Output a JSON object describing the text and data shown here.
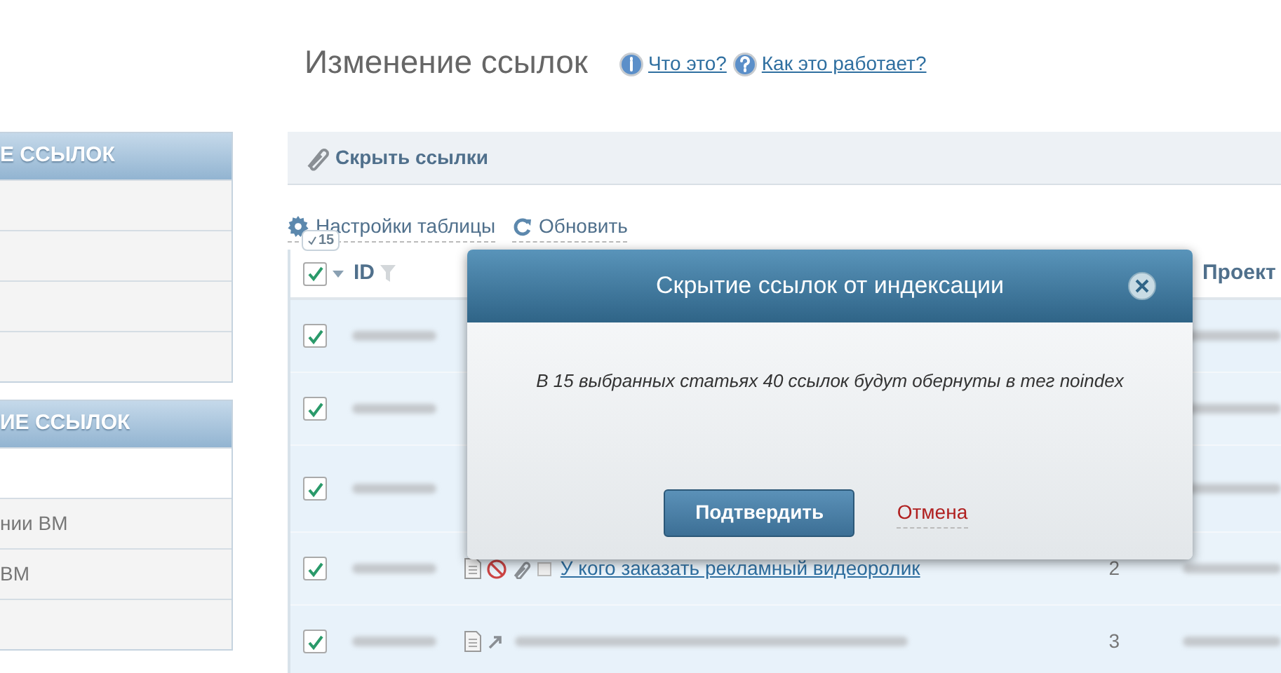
{
  "page": {
    "title": "Изменение ссылок",
    "help_links": [
      {
        "label": "Что это?",
        "kind": "info"
      },
      {
        "label": "Как это работает?",
        "kind": "question"
      }
    ]
  },
  "sidebar": {
    "panels": [
      {
        "title": "Е ССЫЛОК",
        "items": [
          {
            "kind": "blank"
          },
          {
            "kind": "blank"
          },
          {
            "kind": "blank"
          },
          {
            "kind": "blank"
          }
        ]
      },
      {
        "title": "ИЕ ССЫЛОК",
        "items": [
          {
            "kind": "active"
          },
          {
            "kind": "text",
            "label": "нии ВМ"
          },
          {
            "kind": "text",
            "label": "ВМ"
          },
          {
            "kind": "blank"
          }
        ]
      }
    ]
  },
  "toolbar": {
    "button": "Скрыть ссылки"
  },
  "table_actions": [
    {
      "label": "Настройки таблицы",
      "kind": "settings"
    },
    {
      "label": "Обновить",
      "kind": "refresh"
    }
  ],
  "table": {
    "selected_count": "15",
    "all_checked": true,
    "columns": [
      "ID",
      "Проект"
    ],
    "rows": [
      {
        "checked": true
      },
      {
        "checked": true
      },
      {
        "checked": true
      },
      {
        "checked": true,
        "title": "У кого заказать рекламный видеоролик",
        "count": "2"
      },
      {
        "checked": true,
        "count": "3"
      }
    ]
  },
  "dialog": {
    "title": "Скрытие ссылок от индексации",
    "message": "В 15 выбранных статьях 40 ссылок будут обернуты в тег noindex",
    "confirm": "Подтвердить",
    "cancel": "Отмена"
  }
}
